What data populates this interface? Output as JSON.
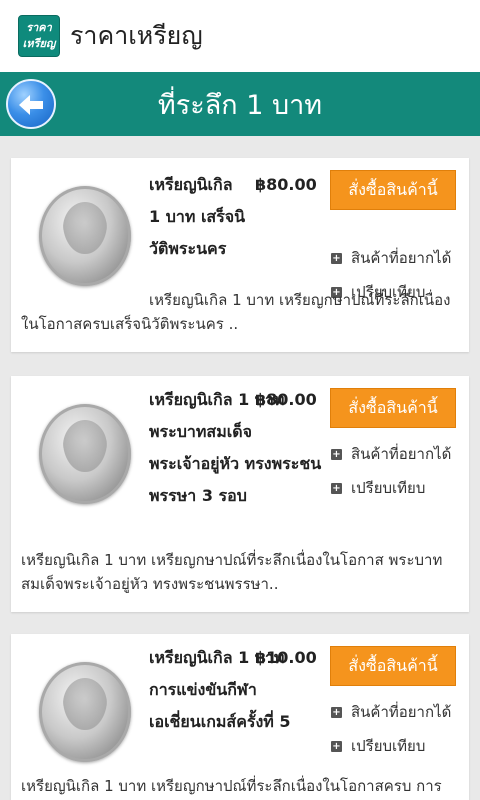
{
  "app": {
    "icon_lines": [
      "ราคา",
      "เหรียญ"
    ],
    "title": "ราคาเหรียญ"
  },
  "page": {
    "title": "ที่ระลึก 1 บาท"
  },
  "products": [
    {
      "name": "เหรียญนิเกิล 1 บาท เสร็จนิวัติพระนคร",
      "price": "฿80.00",
      "buy_label": "สั่งซื้อสินค้านี้",
      "wishlist_label": "สินค้าที่อยากได้",
      "compare_label": "เปรียบเทียบ",
      "description": "เหรียญนิเกิล 1 บาท เหรียญกษาปณ์ที่ระลึกเนื่องในโอกาสครบเสร็จนิวัติพระนคร .."
    },
    {
      "name": "เหรียญนิเกิล 1 บาท พระบาทสมเด็จพระเจ้าอยู่หัว ทรงพระชนพรรษา 3 รอบ",
      "price": "฿80.00",
      "buy_label": "สั่งซื้อสินค้านี้",
      "wishlist_label": "สินค้าที่อยากได้",
      "compare_label": "เปรียบเทียบ",
      "description": "เหรียญนิเกิล 1 บาท เหรียญกษาปณ์ที่ระลึกเนื่องในโอกาส พระบาทสมเด็จพระเจ้าอยู่หัว ทรงพระชนพรรษา.."
    },
    {
      "name": "เหรียญนิเกิล 1 บาท การแข่งขันกีฬาเอเชี่ยนเกมส์ครั้งที่ 5",
      "price": "฿10.00",
      "buy_label": "สั่งซื้อสินค้านี้",
      "wishlist_label": "สินค้าที่อยากได้",
      "compare_label": "เปรียบเทียบ",
      "description": "เหรียญนิเกิล 1 บาท เหรียญกษาปณ์ที่ระลึกเนื่องในโอกาสครบ การ"
    }
  ]
}
